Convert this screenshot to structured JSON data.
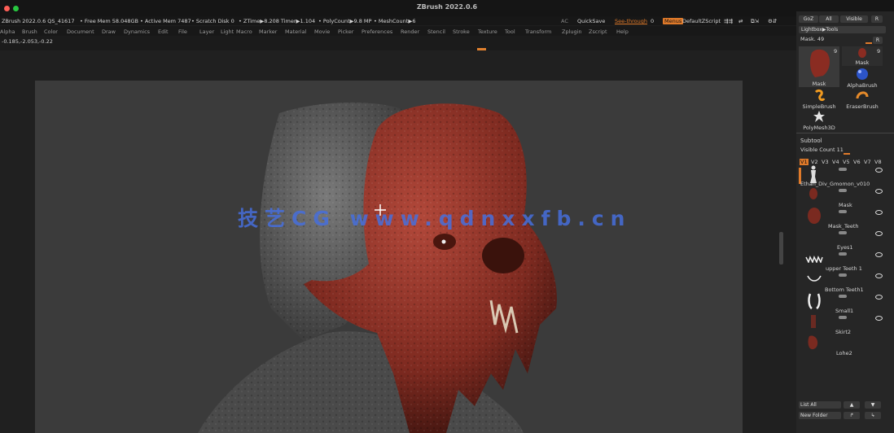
{
  "window": {
    "title": "ZBrush 2022.0.6",
    "colors": {
      "close": "#ff5f57",
      "green": "#28c840",
      "accent": "#e07a2a"
    }
  },
  "status": {
    "version": "ZBrush 2022.0.6 QS_41617",
    "free_mem": "• Free Mem 58.048GB",
    "active_mem": "• Active Mem 7487",
    "scratch": "• Scratch Disk 0",
    "ztime": "• ZTime▶8.208 Timer▶1.104",
    "polycount": "• PolyCount▶9.8 MP",
    "meshcount": "• MeshCount▶6",
    "ac": "AC",
    "quicksave": "QuickSave",
    "see_through": "See-through",
    "see_through_val": "0",
    "menus": "Menus",
    "default_zscript": "DefaultZScript"
  },
  "menu": [
    "Alpha",
    "Brush",
    "Color",
    "Document",
    "Draw",
    "Dynamics",
    "Edit",
    "File",
    "Layer",
    "Light",
    "Macro",
    "Marker",
    "Material",
    "Movie",
    "Picker",
    "Preferences",
    "Render",
    "Stencil",
    "Stroke",
    "Texture",
    "Tool",
    "Transform",
    "Zplugin",
    "Zscript",
    "Help"
  ],
  "coords": "-0.185,-2.053,-0.22",
  "watermark": "技艺CG www.qdnxxfb.cn",
  "right_panel": {
    "goz": "GoZ",
    "all": "All",
    "visible": "Visible",
    "r": "R",
    "lightbox": "Lightbox▶Tools",
    "mask_label": "Mask. 49",
    "brushes": [
      {
        "label": "Mask",
        "count": "9"
      },
      {
        "label": "Mask",
        "count": "9"
      },
      {
        "label": "AlphaBrush",
        "count": ""
      },
      {
        "label": "SimpleBrush",
        "count": ""
      },
      {
        "label": "EraserBrush",
        "count": ""
      },
      {
        "label": "PolyMesh3D",
        "count": ""
      }
    ],
    "subtool_title": "Subtool",
    "visible_count": "Visible Count 11",
    "versions": [
      "V1",
      "V2",
      "V3",
      "V4",
      "V5",
      "V6",
      "V7",
      "V8"
    ],
    "subtools": [
      "Ethan_Div_Gmomon_v010",
      "Mask",
      "Mask_Teeth",
      "Eyes1",
      "upper Teeth 1",
      "Bottom Teeth1",
      "Small1",
      "Skirt2",
      "Lohe2"
    ],
    "list_all": "List All",
    "new_folder": "New Folder"
  }
}
